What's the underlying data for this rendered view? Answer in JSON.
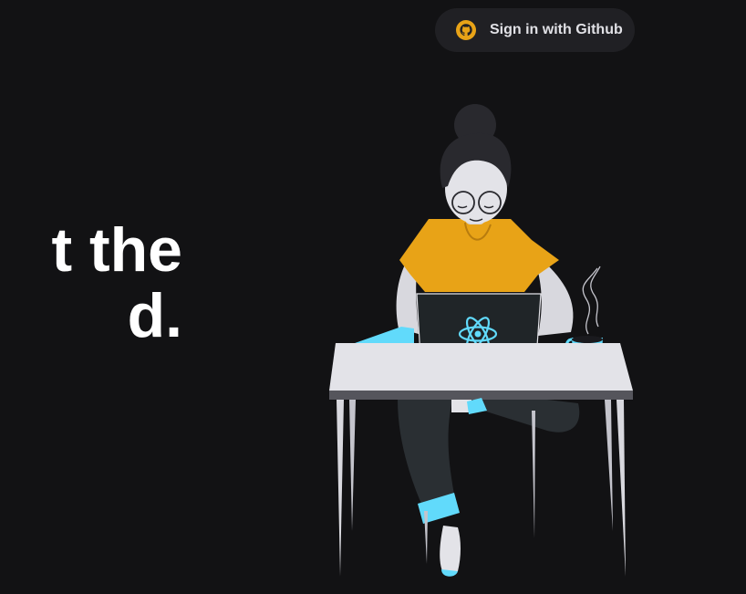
{
  "header": {
    "signin_label": "Sign in with Github",
    "github_icon": "github-icon"
  },
  "hero": {
    "headline_line1": "t the",
    "headline_line2": "d."
  },
  "illustration": {
    "logo_icon": "react-atom-icon"
  },
  "colors": {
    "background": "#121214",
    "button_bg": "#202024",
    "accent_yellow": "#e8a317",
    "accent_cyan": "#61dafb",
    "text": "#ffffff"
  }
}
